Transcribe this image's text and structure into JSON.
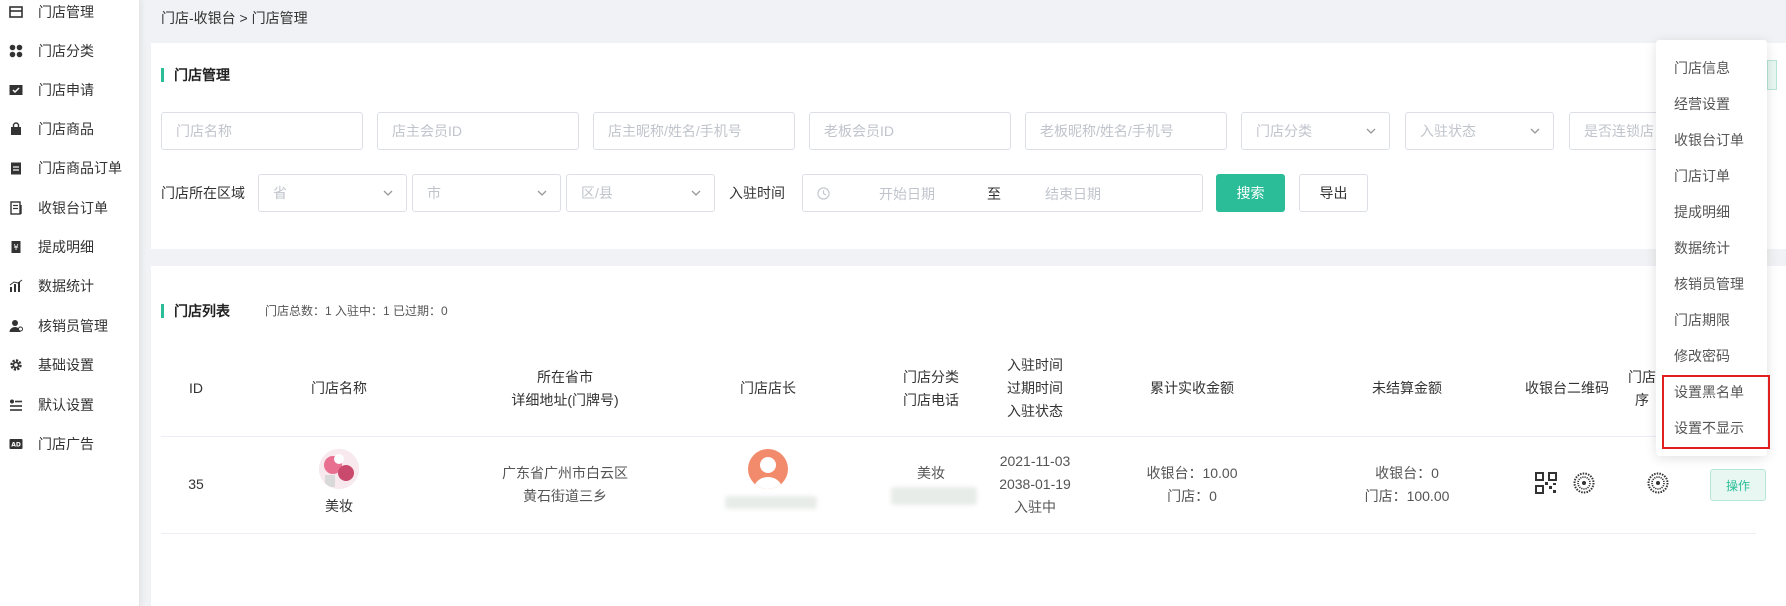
{
  "sidebar": {
    "items": [
      {
        "label": "门店管理",
        "icon": "store-icon"
      },
      {
        "label": "门店分类",
        "icon": "category-icon"
      },
      {
        "label": "门店申请",
        "icon": "folder-check-icon"
      },
      {
        "label": "门店商品",
        "icon": "bag-icon"
      },
      {
        "label": "门店商品订单",
        "icon": "clipboard-icon"
      },
      {
        "label": "收银台订单",
        "icon": "receipt-icon"
      },
      {
        "label": "提成明细",
        "icon": "commission-icon"
      },
      {
        "label": "数据统计",
        "icon": "chart-icon"
      },
      {
        "label": "核销员管理",
        "icon": "user-settings-icon"
      },
      {
        "label": "基础设置",
        "icon": "gear-icon"
      },
      {
        "label": "默认设置",
        "icon": "list-settings-icon"
      },
      {
        "label": "门店广告",
        "icon": "ad-icon"
      }
    ]
  },
  "breadcrumb": "门店-收银台 > 门店管理",
  "filter": {
    "title": "门店管理",
    "placeholders": {
      "store_name": "门店名称",
      "owner_member_id": "店主会员ID",
      "owner_nickname": "店主昵称/姓名/手机号",
      "boss_member_id": "老板会员ID",
      "boss_nickname": "老板昵称/姓名/手机号",
      "store_category": "门店分类",
      "join_status": "入驻状态",
      "chain": "是否连锁店",
      "province": "省",
      "city": "市",
      "district": "区/县",
      "start_date": "开始日期",
      "end_date": "结束日期"
    },
    "region_label": "门店所在区域",
    "join_time_label": "入驻时间",
    "date_sep": "至",
    "search_label": "搜索",
    "export_label": "导出"
  },
  "list": {
    "title": "门店列表",
    "stats": "门店总数：1   入驻中：1   已过期：0",
    "headers": {
      "id": "ID",
      "name": "门店名称",
      "city": "所在省市",
      "address": "详细地址(门牌号)",
      "manager": "门店店长",
      "category": "门店分类",
      "phone": "门店电话",
      "join_time": "入驻时间",
      "expire_time": "过期时间",
      "join_status": "入驻状态",
      "total_received": "累计实收金额",
      "unsettled": "未结算金额",
      "cashier_qr": "收银台二维码",
      "store_qr_a": "门店",
      "store_qr_b": "序"
    },
    "rows": [
      {
        "id": "35",
        "name": "美妆",
        "city": "广东省广州市白云区",
        "address": "黄石街道三乡",
        "category": "美妆",
        "join_time": "2021-11-03",
        "expire_time": "2038-01-19",
        "status": "入驻中",
        "received_cashier": "收银台：10.00",
        "received_store": "门店：0",
        "unsettled_cashier": "收银台：0",
        "unsettled_store": "门店：100.00",
        "action": "操作"
      }
    ]
  },
  "dropdown": {
    "items": [
      "门店信息",
      "经营设置",
      "收银台订单",
      "门店订单",
      "提成明细",
      "数据统计",
      "核销员管理",
      "门店期限",
      "修改密码",
      "设置黑名单",
      "设置不显示"
    ]
  },
  "colors": {
    "accent": "#2bbd98",
    "highlight_border": "#e02020"
  }
}
